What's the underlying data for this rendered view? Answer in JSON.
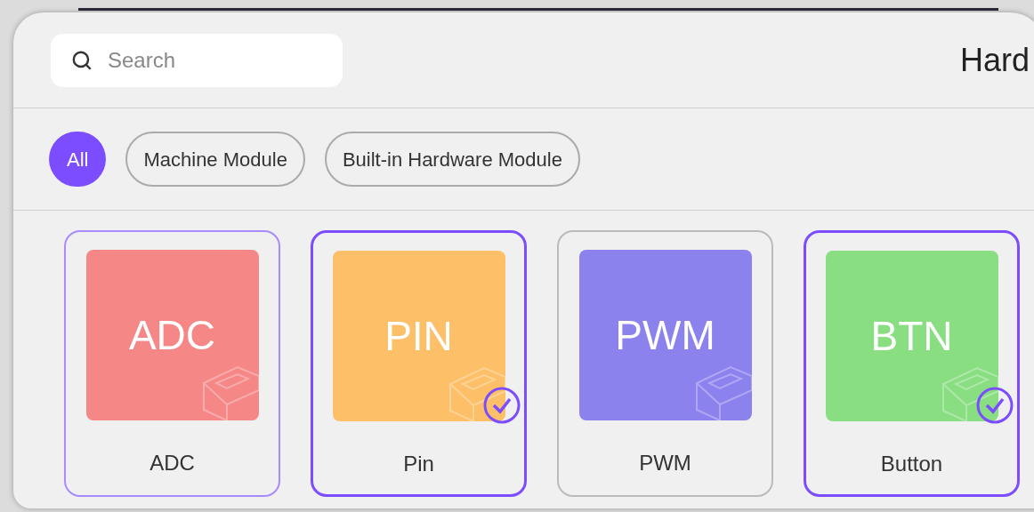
{
  "search": {
    "placeholder": "Search"
  },
  "title": "Hard",
  "filters": [
    {
      "label": "All",
      "selected": true
    },
    {
      "label": "Machine Module",
      "selected": false
    },
    {
      "label": "Built-in Hardware Module",
      "selected": false
    }
  ],
  "modules": [
    {
      "code": "ADC",
      "name": "ADC",
      "color": "#f58787",
      "selected": false,
      "hovered": true
    },
    {
      "code": "PIN",
      "name": "Pin",
      "color": "#fdc068",
      "selected": true,
      "hovered": false
    },
    {
      "code": "PWM",
      "name": "PWM",
      "color": "#8b82ee",
      "selected": false,
      "hovered": false
    },
    {
      "code": "BTN",
      "name": "Button",
      "color": "#89de82",
      "selected": true,
      "hovered": false
    }
  ]
}
